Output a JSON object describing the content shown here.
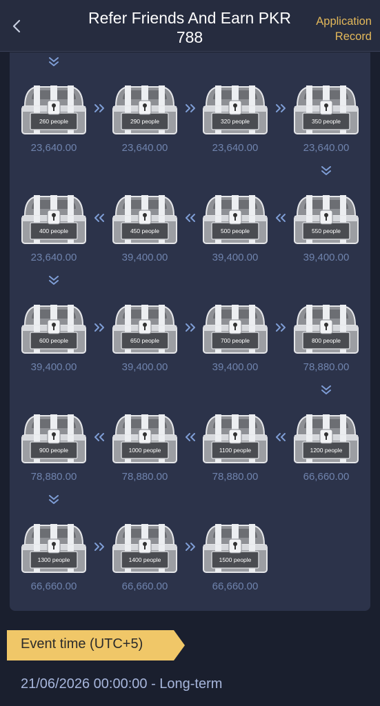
{
  "header": {
    "title": "Refer Friends And Earn PKR 788",
    "record_label": "Application Record",
    "back_icon": "chevron-left-icon"
  },
  "tiers": [
    {
      "label": "260 people",
      "amount": "23,640.00"
    },
    {
      "label": "290 people",
      "amount": "23,640.00"
    },
    {
      "label": "320 people",
      "amount": "23,640.00"
    },
    {
      "label": "350 people",
      "amount": "23,640.00"
    },
    {
      "label": "550 people",
      "amount": "39,400.00"
    },
    {
      "label": "500 people",
      "amount": "39,400.00"
    },
    {
      "label": "450 people",
      "amount": "39,400.00"
    },
    {
      "label": "400 people",
      "amount": "23,640.00"
    },
    {
      "label": "600 people",
      "amount": "39,400.00"
    },
    {
      "label": "650 people",
      "amount": "39,400.00"
    },
    {
      "label": "700 people",
      "amount": "39,400.00"
    },
    {
      "label": "800 people",
      "amount": "78,880.00"
    },
    {
      "label": "1200 people",
      "amount": "66,660.00"
    },
    {
      "label": "1100 people",
      "amount": "78,880.00"
    },
    {
      "label": "1000 people",
      "amount": "78,880.00"
    },
    {
      "label": "900 people",
      "amount": "78,880.00"
    },
    {
      "label": "1300 people",
      "amount": "66,660.00"
    },
    {
      "label": "1400 people",
      "amount": "66,660.00"
    },
    {
      "label": "1500 people",
      "amount": "66,660.00"
    }
  ],
  "event": {
    "label": "Event time (UTC+5)",
    "time": "21/06/2026 00:00:00 - Long-term"
  },
  "colors": {
    "background": "#1a1f2e",
    "panel": "#2c334a",
    "accent": "#e3b85a",
    "amount_text": "#6f83ad"
  }
}
